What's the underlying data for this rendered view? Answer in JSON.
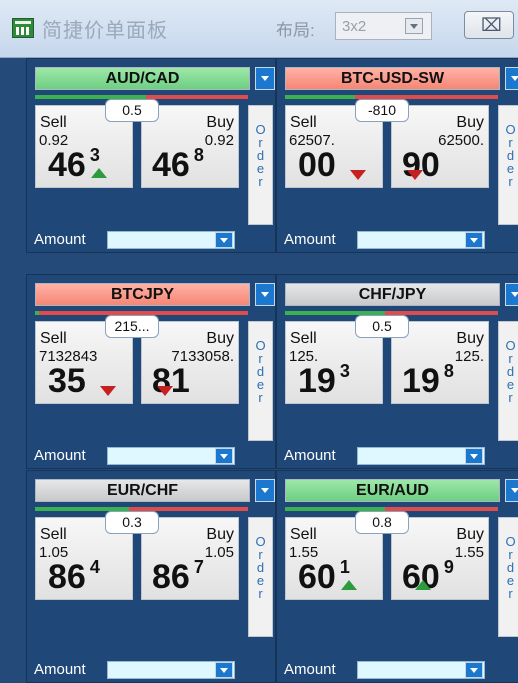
{
  "window": {
    "title": "简捷价单面板",
    "layout_label": "布局:",
    "layout_value": "3x2",
    "close_symbol": "⌧"
  },
  "panels": [
    {
      "pair": "AUD/CAD",
      "pair_color": "green",
      "split_buy_fraction": 0.52,
      "spread": "0.5",
      "sell_label": "Sell",
      "buy_label": "Buy",
      "sell_small": "0.92",
      "buy_small": "0.92",
      "sell_big": "46",
      "sell_pip": "3",
      "buy_big": "46",
      "buy_pip": "8",
      "sell_arrow": "up",
      "buy_arrow": "none",
      "order_label": [
        "O",
        "r",
        "d",
        "e",
        "r"
      ],
      "amount_label": "Amount"
    },
    {
      "pair": "BTC-USD-SW",
      "pair_color": "red",
      "split_buy_fraction": 0.33,
      "spread": "-810",
      "sell_label": "Sell",
      "buy_label": "Buy",
      "sell_small": "62507.",
      "buy_small": "62500.",
      "sell_big": "00",
      "sell_pip": "",
      "buy_big": "90",
      "buy_pip": "",
      "sell_arrow": "down",
      "buy_arrow": "down",
      "order_label": [
        "O",
        "r",
        "d",
        "e",
        "r"
      ],
      "amount_label": "Amount"
    },
    {
      "pair": "BTCJPY",
      "pair_color": "red",
      "split_buy_fraction": 0.02,
      "spread": "215...",
      "sell_label": "Sell",
      "buy_label": "Buy",
      "sell_small": "7132843",
      "buy_small": "7133058.",
      "sell_big": "35",
      "sell_pip": "",
      "buy_big": "81",
      "buy_pip": "",
      "sell_arrow": "down",
      "buy_arrow": "down",
      "order_label": [
        "O",
        "r",
        "d",
        "e",
        "r"
      ],
      "amount_label": "Amount"
    },
    {
      "pair": "CHF/JPY",
      "pair_color": "gray",
      "split_buy_fraction": 0.47,
      "spread": "0.5",
      "sell_label": "Sell",
      "buy_label": "Buy",
      "sell_small": "125.",
      "buy_small": "125.",
      "sell_big": "19",
      "sell_pip": "3",
      "buy_big": "19",
      "buy_pip": "8",
      "sell_arrow": "none",
      "buy_arrow": "none",
      "order_label": [
        "O",
        "r",
        "d",
        "e",
        "r"
      ],
      "amount_label": "Amount"
    },
    {
      "pair": "EUR/CHF",
      "pair_color": "gray",
      "split_buy_fraction": 0.44,
      "spread": "0.3",
      "sell_label": "Sell",
      "buy_label": "Buy",
      "sell_small": "1.05",
      "buy_small": "1.05",
      "sell_big": "86",
      "sell_pip": "4",
      "buy_big": "86",
      "buy_pip": "7",
      "sell_arrow": "none",
      "buy_arrow": "none",
      "order_label": [
        "O",
        "r",
        "d",
        "e",
        "r"
      ],
      "amount_label": "Amount"
    },
    {
      "pair": "EUR/AUD",
      "pair_color": "green",
      "split_buy_fraction": 0.47,
      "spread": "0.8",
      "sell_label": "Sell",
      "buy_label": "Buy",
      "sell_small": "1.55",
      "buy_small": "1.55",
      "sell_big": "60",
      "sell_pip": "1",
      "buy_big": "60",
      "buy_pip": "9",
      "sell_arrow": "up",
      "buy_arrow": "up",
      "order_label": [
        "O",
        "r",
        "d",
        "e",
        "r"
      ],
      "amount_label": "Amount"
    }
  ],
  "colors": {
    "up": "#2c9b3d",
    "down": "#c62020",
    "green_pair": "#6ccf81",
    "red_pair": "#f58674",
    "gray_pair": "#c7c9cb"
  }
}
